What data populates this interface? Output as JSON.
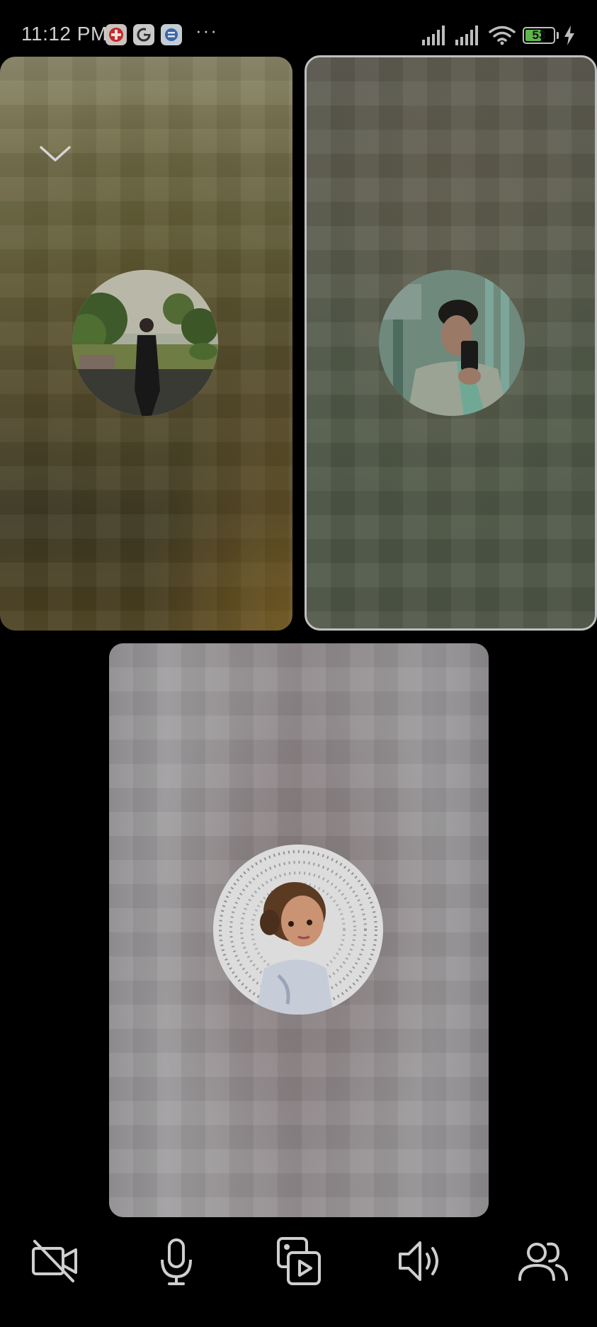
{
  "status_bar": {
    "time": "11:12 PM",
    "overflow": "···",
    "battery_level": "53",
    "notification_icons": [
      "red-app-icon",
      "google-icon",
      "messages-app-icon"
    ]
  },
  "call": {
    "participants": [
      {
        "id": "participant-1",
        "avatar": "woman-in-park-photo"
      },
      {
        "id": "participant-2",
        "avatar": "man-mirror-selfie-photo"
      },
      {
        "id": "participant-3",
        "avatar": "illustrated-woman-portrait"
      }
    ],
    "controls": [
      {
        "id": "camera",
        "icon": "video-off-icon"
      },
      {
        "id": "mic",
        "icon": "microphone-icon"
      },
      {
        "id": "share",
        "icon": "media-share-icon"
      },
      {
        "id": "speaker",
        "icon": "speaker-icon"
      },
      {
        "id": "people",
        "icon": "people-icon"
      }
    ],
    "colors": {
      "end_call": "#c81d3a",
      "active_tile_border": "#bfbfbf",
      "background": "#000000"
    }
  }
}
